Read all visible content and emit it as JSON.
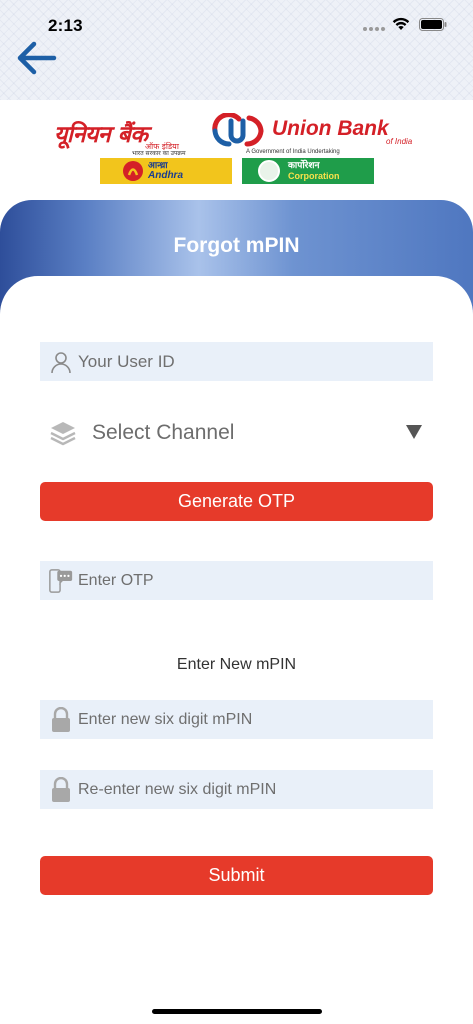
{
  "status_bar": {
    "time": "2:13"
  },
  "header": {
    "back_label": "Back"
  },
  "brand": {
    "hindi_name": "यूनियन बैंक",
    "hindi_sub": "ऑफ इंडिया",
    "english_name": "Union Bank",
    "english_sub": "of India",
    "tagline_hindi": "भारत सरकार का उपक्रम",
    "tagline_english": "A Government of India Undertaking",
    "andhra_hindi": "आन्ध्रा",
    "andhra_english": "Andhra",
    "corp_hindi": "कार्पोरेशन",
    "corp_english": "Corporation",
    "brand_red": "#d42027"
  },
  "page": {
    "title": "Forgot mPIN"
  },
  "form": {
    "user_id_placeholder": "Your User ID",
    "channel_label": "Select Channel",
    "generate_otp_label": "Generate OTP",
    "otp_placeholder": "Enter OTP",
    "new_mpin_heading": "Enter New mPIN",
    "new_mpin_placeholder": "Enter new six digit mPIN",
    "reenter_mpin_placeholder": "Re-enter new six digit mPIN",
    "submit_label": "Submit"
  },
  "colors": {
    "button_red": "#e63a2a",
    "field_bg": "#e9f0f9",
    "header_blue": "#5a7fc4"
  }
}
